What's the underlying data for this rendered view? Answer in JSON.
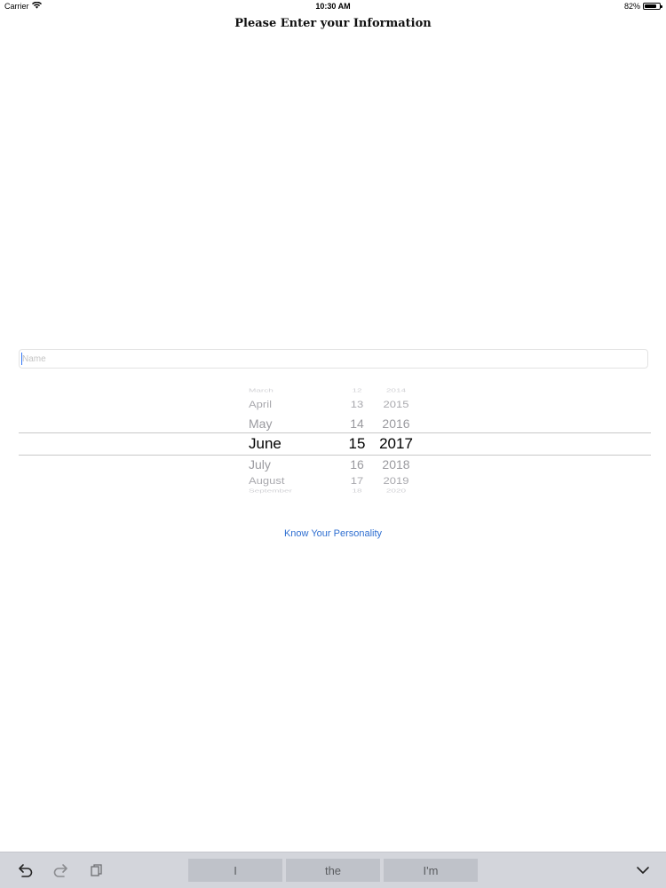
{
  "status_bar": {
    "carrier": "Carrier",
    "time": "10:30 AM",
    "battery_text": "82%",
    "battery_level": 0.82,
    "wifi_icon": "wifi-icon",
    "battery_icon": "battery-icon"
  },
  "page": {
    "title": "Please Enter your Information"
  },
  "name_field": {
    "placeholder": "Name",
    "value": ""
  },
  "date_picker": {
    "months": [
      "March",
      "April",
      "May",
      "June",
      "July",
      "August",
      "September"
    ],
    "days": [
      "12",
      "13",
      "14",
      "15",
      "16",
      "17",
      "18"
    ],
    "years": [
      "2014",
      "2015",
      "2016",
      "2017",
      "2018",
      "2019",
      "2020"
    ],
    "selected": {
      "month": "June",
      "day": "15",
      "year": "2017"
    }
  },
  "actions": {
    "know_personality": "Know Your Personality"
  },
  "keyboard_bar": {
    "suggestions": [
      "I",
      "the",
      "I'm"
    ],
    "undo_icon": "undo-icon",
    "redo_icon": "redo-icon",
    "paste_icon": "paste-icon",
    "dismiss_icon": "chevron-down-icon"
  }
}
